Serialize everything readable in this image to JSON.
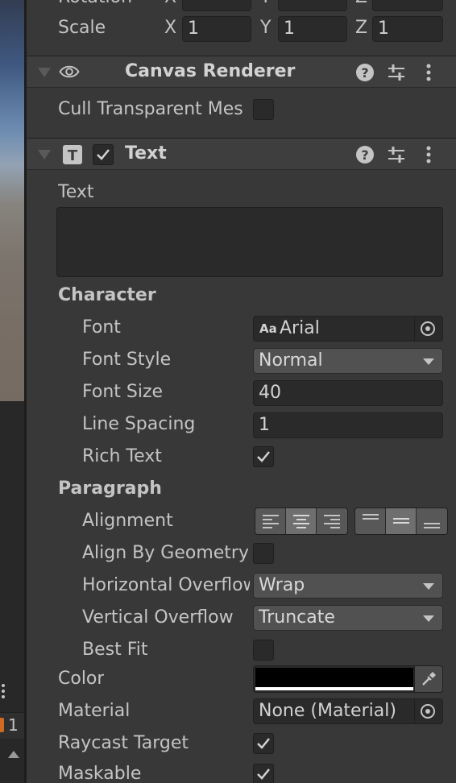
{
  "transform": {
    "rotation_label": "Rotation",
    "rotation": {
      "x_axis": "X",
      "x": "",
      "y_axis": "Y",
      "y": "",
      "z_axis": "Z",
      "z": ""
    },
    "scale_label": "Scale",
    "scale": {
      "x_axis": "X",
      "x": "1",
      "y_axis": "Y",
      "y": "1",
      "z_axis": "Z",
      "z": "1"
    }
  },
  "canvas_renderer": {
    "title": "Canvas Renderer",
    "icon": "eye-icon",
    "cull_label": "Cull Transparent Mes",
    "cull_checked": false
  },
  "text_component": {
    "title": "Text",
    "icon": "text-t-icon",
    "enabled": true,
    "text_label": "Text",
    "text_value": "",
    "character_header": "Character",
    "font_label": "Font",
    "font_value": "Arial",
    "font_prefix": "Aa",
    "font_style_label": "Font Style",
    "font_style_value": "Normal",
    "font_size_label": "Font Size",
    "font_size_value": "40",
    "line_spacing_label": "Line Spacing",
    "line_spacing_value": "1",
    "rich_text_label": "Rich Text",
    "rich_text_checked": true,
    "paragraph_header": "Paragraph",
    "alignment_label": "Alignment",
    "alignment_horizontal_selected": "center",
    "alignment_vertical_selected": "middle",
    "align_by_geometry_label": "Align By Geometry",
    "align_by_geometry_checked": false,
    "h_overflow_label": "Horizontal Overflow",
    "h_overflow_value": "Wrap",
    "v_overflow_label": "Vertical Overflow",
    "v_overflow_value": "Truncate",
    "best_fit_label": "Best Fit",
    "best_fit_checked": false,
    "color_label": "Color",
    "color_value": "#000000",
    "material_label": "Material",
    "material_value": "None (Material)",
    "raycast_label": "Raycast Target",
    "raycast_checked": true,
    "maskable_label": "Maskable",
    "maskable_checked": true
  },
  "hierarchy": {
    "warning_count": "1"
  },
  "colors": {
    "panel": "#383838",
    "header": "#3e3e3e",
    "field": "#2a2a2a",
    "text": "#c4c4c4"
  }
}
